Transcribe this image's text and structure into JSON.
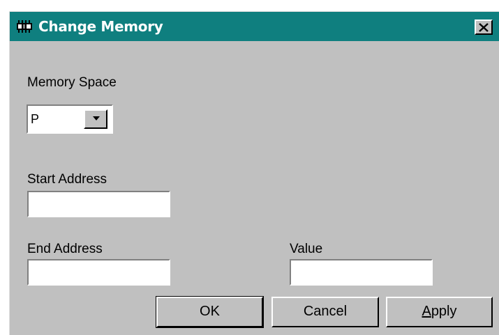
{
  "dialog": {
    "title": "Change Memory",
    "title_icon": "memory-chip-icon",
    "close_icon": "close-icon"
  },
  "memory_space": {
    "label": "Memory Space",
    "selected": "P"
  },
  "start_address": {
    "label": "Start Address",
    "value": ""
  },
  "end_address": {
    "label": "End Address",
    "value": ""
  },
  "value_field": {
    "label": "Value",
    "value": ""
  },
  "buttons": {
    "ok": "OK",
    "cancel": "Cancel",
    "apply": "Apply",
    "apply_mnemonic": "A",
    "apply_rest": "pply"
  },
  "colors": {
    "titlebar": "#0f7f7f",
    "dialog_bg": "#c0c0c0",
    "title_text": "#ffffff"
  }
}
